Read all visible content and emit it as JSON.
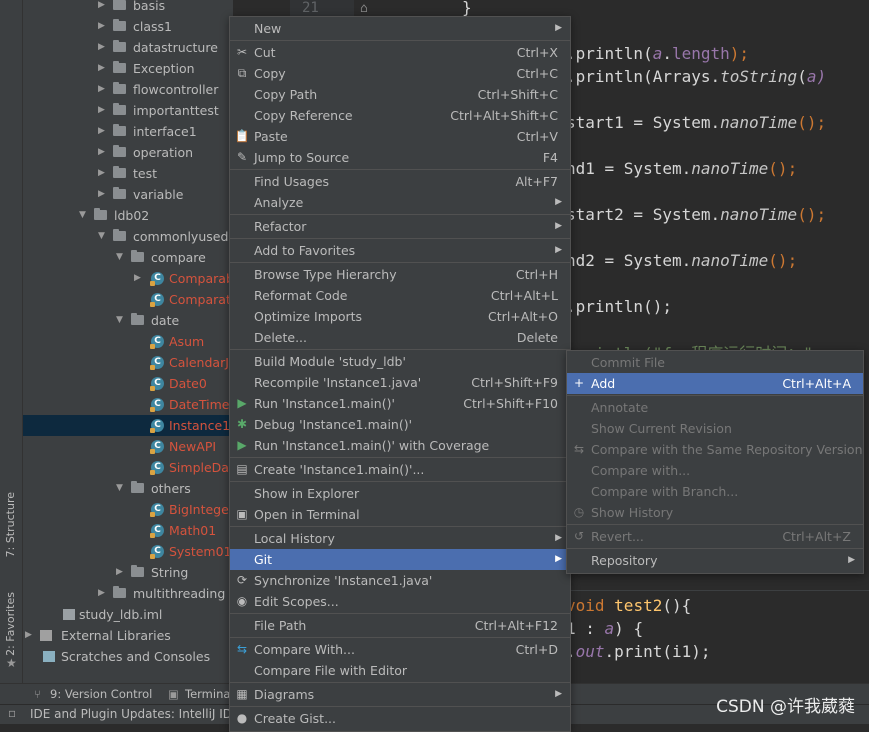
{
  "left_stripe": {
    "structure_label": "7: Structure",
    "favorites_label": "2: Favorites"
  },
  "tree": {
    "items": [
      {
        "label": "basis"
      },
      {
        "label": "class1"
      },
      {
        "label": "datastructure"
      },
      {
        "label": "Exception"
      },
      {
        "label": "flowcontroller"
      },
      {
        "label": "importanttest"
      },
      {
        "label": "interface1"
      },
      {
        "label": "operation"
      },
      {
        "label": "test"
      },
      {
        "label": "variable"
      },
      {
        "label": "ldb02"
      },
      {
        "label": "commonlyusedcl"
      },
      {
        "label": "compare"
      },
      {
        "label": "Comparab"
      },
      {
        "label": "Comparato"
      },
      {
        "label": "date"
      },
      {
        "label": "Asum"
      },
      {
        "label": "CalendarJa"
      },
      {
        "label": "Date0"
      },
      {
        "label": "DateTimeF"
      },
      {
        "label": "Instance1"
      },
      {
        "label": "NewAPI"
      },
      {
        "label": "SimpleDat"
      },
      {
        "label": "others"
      },
      {
        "label": "BigInteger"
      },
      {
        "label": "Math01"
      },
      {
        "label": "System01"
      },
      {
        "label": "String"
      },
      {
        "label": "multithreading"
      },
      {
        "label": "study_ldb.iml"
      },
      {
        "label": "External Libraries"
      },
      {
        "label": "Scratches and Consoles"
      }
    ]
  },
  "editor": {
    "line_number": "21",
    "lines": {
      "l0": "}",
      "l1a": ".println(",
      "l1b": "a",
      "l1c": ".",
      "l1d": "length",
      "l1e": ");",
      "l2a": ".println(Arrays.",
      "l2b": "toString",
      "l2c": "(",
      "l2d": "a)",
      "l3a": "start1 = System.",
      "l3b": "nanoTime",
      "l3c": "();",
      "l4a": "nd1 = System.",
      "l4b": "nanoTime",
      "l4c": "();",
      "l5a": "start2 = System.",
      "l5b": "nanoTime",
      "l5c": "();",
      "l6a": "nd2 = System.",
      "l6b": "nanoTime",
      "l6c": "();",
      "l7": ".println();",
      "l8a": ".println(\"for程序运行时间：\"",
      "l9a": "void ",
      "l9b": "test2",
      "l9c": "(){",
      "l10a": "1 : ",
      "l10b": "a",
      "l10c": ") {",
      "l11a": ".",
      "l11b": "out",
      "l11c": ".print(i1);"
    }
  },
  "context_menu": {
    "items": [
      {
        "label": "New",
        "shortcut": "",
        "submenu": true
      },
      {
        "label": "Cut",
        "shortcut": "Ctrl+X"
      },
      {
        "label": "Copy",
        "shortcut": "Ctrl+C"
      },
      {
        "label": "Copy Path",
        "shortcut": "Ctrl+Shift+C"
      },
      {
        "label": "Copy Reference",
        "shortcut": "Ctrl+Alt+Shift+C"
      },
      {
        "label": "Paste",
        "shortcut": "Ctrl+V"
      },
      {
        "label": "Jump to Source",
        "shortcut": "F4"
      },
      {
        "label": "Find Usages",
        "shortcut": "Alt+F7"
      },
      {
        "label": "Analyze",
        "shortcut": "",
        "submenu": true
      },
      {
        "label": "Refactor",
        "shortcut": "",
        "submenu": true
      },
      {
        "label": "Add to Favorites",
        "shortcut": "",
        "submenu": true
      },
      {
        "label": "Browse Type Hierarchy",
        "shortcut": "Ctrl+H"
      },
      {
        "label": "Reformat Code",
        "shortcut": "Ctrl+Alt+L"
      },
      {
        "label": "Optimize Imports",
        "shortcut": "Ctrl+Alt+O"
      },
      {
        "label": "Delete...",
        "shortcut": "Delete"
      },
      {
        "label": "Build Module 'study_ldb'",
        "shortcut": ""
      },
      {
        "label": "Recompile 'Instance1.java'",
        "shortcut": "Ctrl+Shift+F9"
      },
      {
        "label": "Run 'Instance1.main()'",
        "shortcut": "Ctrl+Shift+F10"
      },
      {
        "label": "Debug 'Instance1.main()'",
        "shortcut": ""
      },
      {
        "label": "Run 'Instance1.main()' with Coverage",
        "shortcut": ""
      },
      {
        "label": "Create 'Instance1.main()'...",
        "shortcut": ""
      },
      {
        "label": "Show in Explorer",
        "shortcut": ""
      },
      {
        "label": "Open in Terminal",
        "shortcut": ""
      },
      {
        "label": "Local History",
        "shortcut": "",
        "submenu": true
      },
      {
        "label": "Git",
        "shortcut": "",
        "submenu": true
      },
      {
        "label": "Synchronize 'Instance1.java'",
        "shortcut": ""
      },
      {
        "label": "Edit Scopes...",
        "shortcut": ""
      },
      {
        "label": "File Path",
        "shortcut": "Ctrl+Alt+F12"
      },
      {
        "label": "Compare With...",
        "shortcut": "Ctrl+D"
      },
      {
        "label": "Compare File with Editor",
        "shortcut": ""
      },
      {
        "label": "Diagrams",
        "shortcut": "",
        "submenu": true
      },
      {
        "label": "Create Gist...",
        "shortcut": ""
      }
    ]
  },
  "git_submenu": {
    "items": [
      {
        "label": "Commit File",
        "shortcut": ""
      },
      {
        "label": "Add",
        "shortcut": "Ctrl+Alt+A"
      },
      {
        "label": "Annotate",
        "shortcut": ""
      },
      {
        "label": "Show Current Revision",
        "shortcut": ""
      },
      {
        "label": "Compare with the Same Repository Version",
        "shortcut": ""
      },
      {
        "label": "Compare with...",
        "shortcut": ""
      },
      {
        "label": "Compare with Branch...",
        "shortcut": ""
      },
      {
        "label": "Show History",
        "shortcut": ""
      },
      {
        "label": "Revert...",
        "shortcut": "Ctrl+Alt+Z"
      },
      {
        "label": "Repository",
        "shortcut": "",
        "submenu": true
      }
    ]
  },
  "toolwindow_bar": {
    "version_control": "9: Version Control",
    "terminal": "Terminal"
  },
  "status_bar": {
    "message": "IDE and Plugin Updates: IntelliJ ID"
  },
  "watermark": "CSDN @许我葳蕤",
  "colors": {
    "menu_bg": "#3c3f41",
    "selection": "#4b6eaf",
    "editor_bg": "#2b2b2b",
    "error_red": "#d5533d"
  }
}
